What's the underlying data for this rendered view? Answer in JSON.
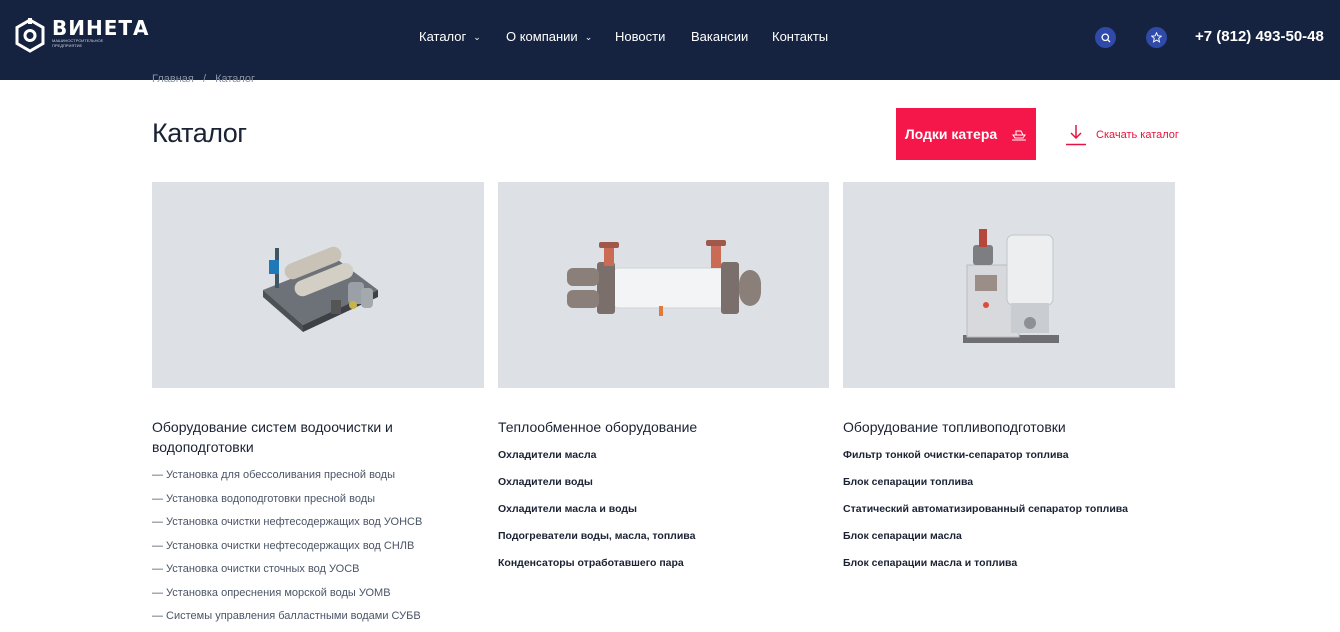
{
  "header": {
    "logo_name": "ВИНЕТА",
    "logo_sub": "машиностроительное предприятие",
    "nav": [
      {
        "label": "Каталог",
        "has_dropdown": true
      },
      {
        "label": "О компании",
        "has_dropdown": true
      },
      {
        "label": "Новости",
        "has_dropdown": false
      },
      {
        "label": "Вакансии",
        "has_dropdown": false
      },
      {
        "label": "Контакты",
        "has_dropdown": false
      }
    ],
    "search_icon": "search-icon",
    "favorites_icon": "star-icon",
    "phone": "+7 (812) 493-50-48",
    "colors": {
      "background": "#152340",
      "icon_button": "#2f4aa8"
    }
  },
  "breadcrumb": {
    "home": "Главная",
    "separator": "/",
    "current": "Каталог"
  },
  "page": {
    "title": "Каталог",
    "boats_button": "Лодки катера",
    "download_label": "Скачать каталог",
    "accent": "#f5164a"
  },
  "categories": [
    {
      "title": "Оборудование систем водоочистки и водоподготовки",
      "image": "water-treatment-unit",
      "items": [
        "— Установка для обессоливания пресной воды",
        "— Установка водоподготовки пресной воды",
        "— Установка очистки нефтесодержащих вод УОНСВ",
        "— Установка очистки нефтесодержащих вод СНЛВ",
        "— Установка очистки сточных вод УОСВ",
        "— Установка опреснения морской воды УОМВ",
        "— Системы управления балластными водами СУБВ"
      ]
    },
    {
      "title": "Теплообменное оборудование",
      "image": "heat-exchanger",
      "items": [
        "Охладители масла",
        "Охладители воды",
        "Охладители масла и воды",
        "Подогреватели воды, масла, топлива",
        "Конденсаторы отработавшего пара"
      ]
    },
    {
      "title": "Оборудование топливоподготовки",
      "image": "fuel-separator",
      "items": [
        "Фильтр тонкой очистки-сепаратор топлива",
        "Блок сепарации топлива",
        "Статический автоматизированный сепаратор топлива",
        "Блок сепарации масла",
        "Блок сепарации масла и топлива"
      ]
    }
  ]
}
